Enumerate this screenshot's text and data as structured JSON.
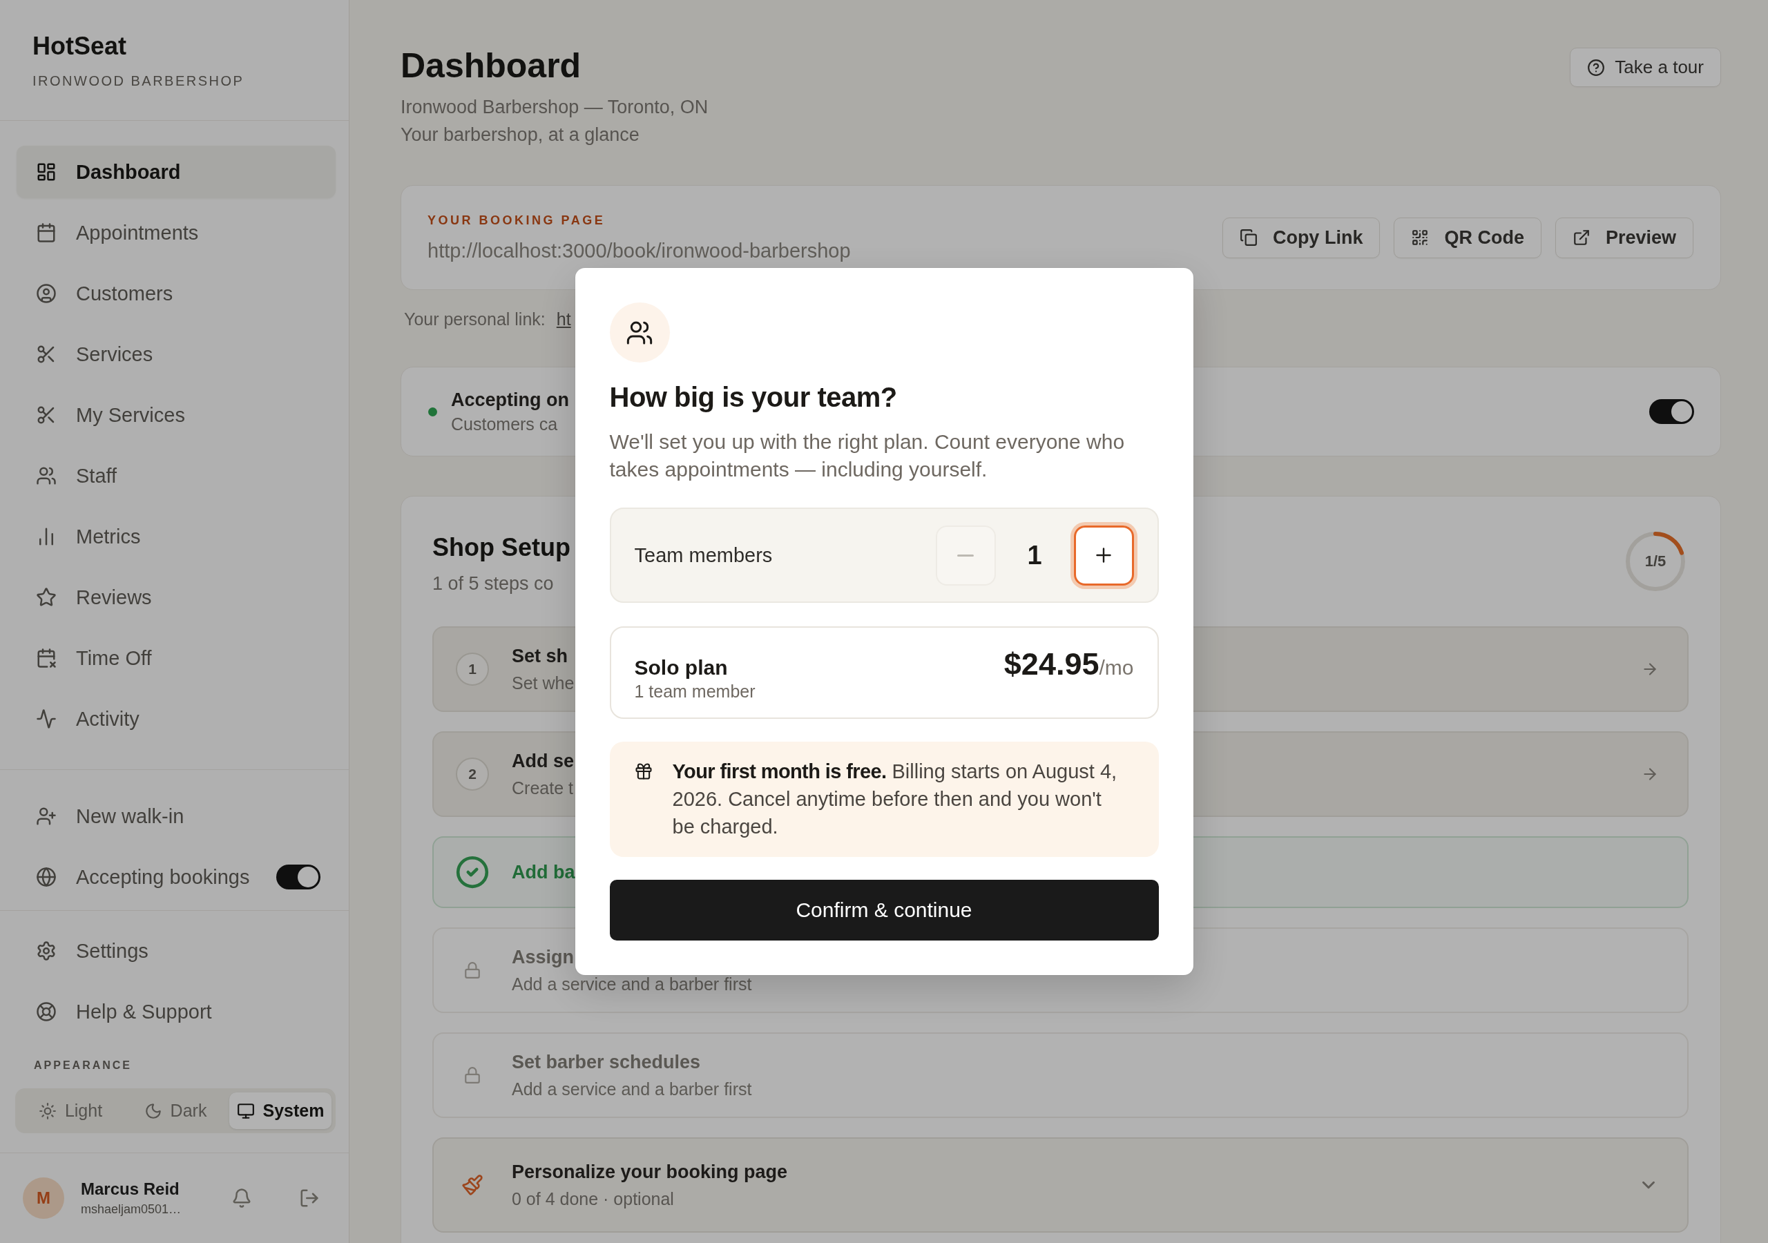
{
  "sidebar": {
    "brand": "HotSeat",
    "shop_name": "IRONWOOD BARBERSHOP",
    "nav": [
      {
        "label": "Dashboard",
        "selected": true
      },
      {
        "label": "Appointments",
        "selected": false
      },
      {
        "label": "Customers",
        "selected": false
      },
      {
        "label": "Services",
        "selected": false
      },
      {
        "label": "My Services",
        "selected": false
      },
      {
        "label": "Staff",
        "selected": false
      },
      {
        "label": "Metrics",
        "selected": false
      },
      {
        "label": "Reviews",
        "selected": false
      },
      {
        "label": "Time Off",
        "selected": false
      },
      {
        "label": "Activity",
        "selected": false
      }
    ],
    "quick_actions": [
      {
        "kind": "link",
        "label": "New walk-in"
      },
      {
        "kind": "toggle",
        "label": "Accepting bookings",
        "on": true
      }
    ],
    "links": [
      {
        "label": "Settings"
      },
      {
        "label": "Help & Support"
      }
    ],
    "appearance": {
      "label": "APPEARANCE",
      "options": [
        {
          "label": "Light",
          "selected": false
        },
        {
          "label": "Dark",
          "selected": false
        },
        {
          "label": "System",
          "selected": true
        }
      ]
    },
    "user": {
      "initial": "M",
      "name": "Marcus Reid",
      "email": "mshaeljam0501…"
    }
  },
  "main": {
    "header": {
      "title": "Dashboard",
      "location": "Ironwood Barbershop — Toronto, ON",
      "tagline": "Your barbershop, at a glance",
      "tour_button": "Take a tour"
    },
    "booking_page": {
      "label": "YOUR BOOKING PAGE",
      "url": "http://localhost:3000/book/ironwood-barbershop",
      "buttons": [
        "Copy Link",
        "QR Code",
        "Preview"
      ]
    },
    "personal_link": {
      "label": "Your personal link:",
      "link": "ht"
    },
    "accepting": {
      "title": "Accepting on",
      "subtitle": "Customers ca",
      "on": true
    },
    "shop_setup": {
      "title": "Shop Setup",
      "progress": "1 of 5 steps co",
      "ring": {
        "label": "1/5",
        "level": 0.2
      },
      "steps": [
        {
          "kind": "todo",
          "number": "1",
          "title": "Set sh",
          "subtitle": "Set whe"
        },
        {
          "kind": "todo",
          "number": "2",
          "title": "Add se",
          "subtitle": "Create t"
        },
        {
          "kind": "done",
          "title": "Add ba"
        },
        {
          "kind": "locked",
          "title": "Assign",
          "subtitle": "Add a service and a barber first"
        },
        {
          "kind": "locked",
          "title": "Set barber schedules",
          "subtitle": "Add a service and a barber first"
        }
      ],
      "group": {
        "title": "Personalize your booking page",
        "subtitle": "0 of 4 done · optional",
        "expanded": false
      }
    }
  },
  "modal": {
    "title": "How big is your team?",
    "description": "We'll set you up with the right plan. Count everyone who takes appointments — including yourself.",
    "stepper": {
      "label": "Team members",
      "value": "1",
      "decrement_disabled": true,
      "increment_focused": true
    },
    "plan": {
      "name": "Solo plan",
      "detail": "1 team member",
      "price": "$24.95",
      "period": "/mo"
    },
    "notice": "**Your first month is free.** Billing starts on August 4, 2026. Cancel anytime before then and you won't be charged.",
    "confirm": "Confirm & continue"
  }
}
